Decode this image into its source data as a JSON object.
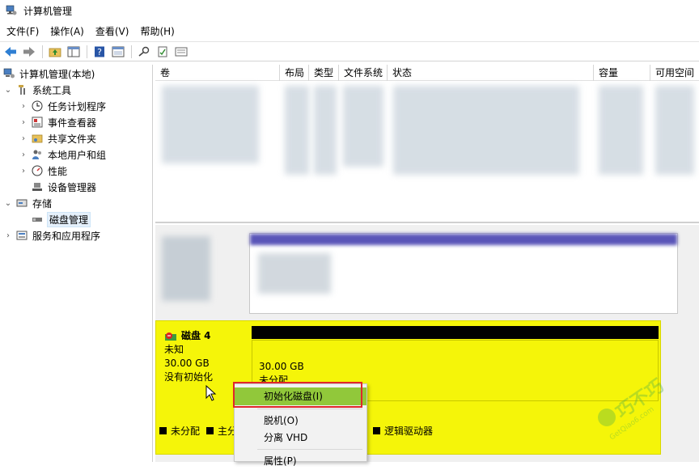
{
  "window": {
    "title": "计算机管理"
  },
  "menu": [
    "文件(F)",
    "操作(A)",
    "查看(V)",
    "帮助(H)"
  ],
  "toolbar": {
    "icons": [
      "back-arrow-icon",
      "forward-arrow-icon",
      "up-folder-icon",
      "show-hide-tree-icon",
      "help-icon",
      "console-view-icon",
      "search-icon",
      "check-document-icon",
      "properties-icon"
    ]
  },
  "tree": {
    "root": "计算机管理(本地)",
    "system_tools": "系统工具",
    "task_scheduler": "任务计划程序",
    "event_viewer": "事件查看器",
    "shared_folders": "共享文件夹",
    "local_users": "本地用户和组",
    "performance": "性能",
    "device_manager": "设备管理器",
    "storage": "存储",
    "disk_management": "磁盘管理",
    "services_apps": "服务和应用程序"
  },
  "volume_table": {
    "columns": [
      "卷",
      "布局",
      "类型",
      "文件系统",
      "状态",
      "容量",
      "可用空间"
    ]
  },
  "disk4": {
    "name": "磁盘 4",
    "type": "未知",
    "size": "30.00 GB",
    "state": "没有初始化",
    "partition_size": "30.00 GB",
    "partition_state": "未分配"
  },
  "legend": [
    "未分配",
    "主分",
    "逻辑驱动器"
  ],
  "context_menu": {
    "items": [
      "初始化磁盘(I)",
      "脱机(O)",
      "分离 VHD",
      "属性(P)"
    ]
  },
  "watermark": {
    "text": "巧不巧",
    "subtext": "GetQiao6.com"
  },
  "colors": {
    "highlight": "#f5f509",
    "menu_hover": "#91c83a",
    "callout": "#e0272a",
    "volume_header": "#5a55b8"
  }
}
